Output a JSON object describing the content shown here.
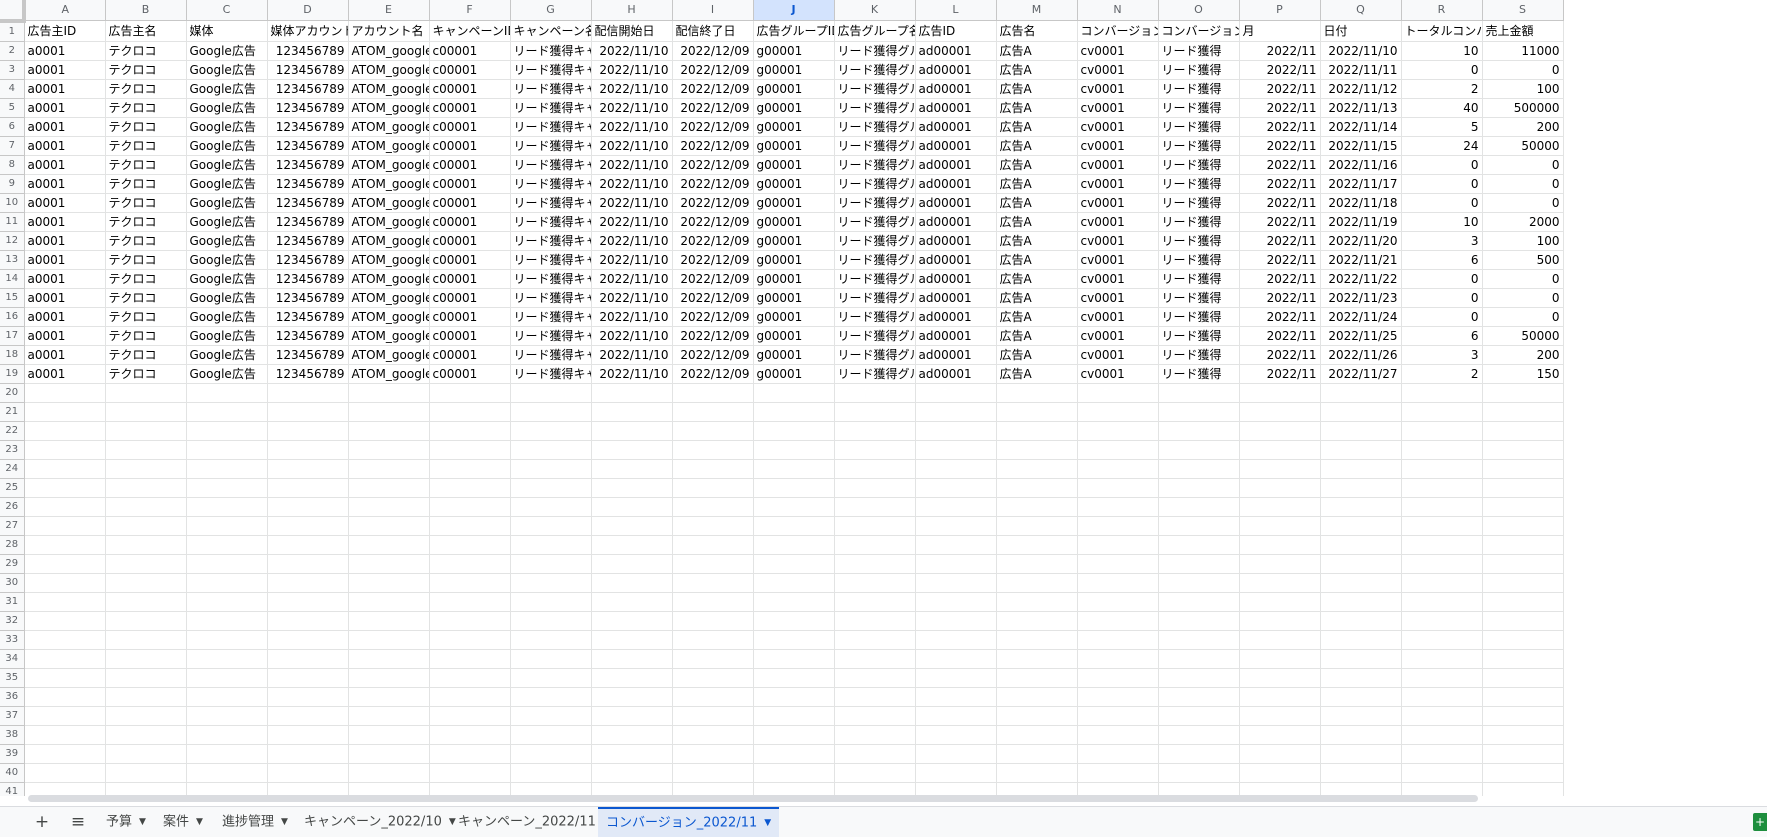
{
  "sheet": {
    "columns": [
      "A",
      "B",
      "C",
      "D",
      "E",
      "F",
      "G",
      "H",
      "I",
      "J",
      "K",
      "L",
      "M",
      "N",
      "O",
      "P",
      "Q",
      "R",
      "S"
    ],
    "selected_column": "J",
    "header_row": [
      "広告主ID",
      "広告主名",
      "媒体",
      "媒体アカウントI",
      "アカウント名",
      "キャンペーンID",
      "キャンペーン名",
      "配信開始日",
      "配信終了日",
      "広告グループID",
      "広告グループ名",
      "広告ID",
      "広告名",
      "コンバージョンI",
      "コンバージョン名",
      "月",
      "日付",
      "トータルコンバ-",
      "売上金額"
    ],
    "numeric_columns": [
      3,
      7,
      8,
      15,
      16,
      17,
      18
    ],
    "rows": [
      [
        "a0001",
        "テクロコ",
        "Google広告",
        "123456789",
        "ATOM_google",
        "c00001",
        "リード獲得キャン",
        "2022/11/10",
        "2022/12/09",
        "g00001",
        "リード獲得グルー",
        "ad00001",
        "広告A",
        "cv0001",
        "リード獲得",
        "2022/11",
        "2022/11/10",
        "10",
        "11000"
      ],
      [
        "a0001",
        "テクロコ",
        "Google広告",
        "123456789",
        "ATOM_google",
        "c00001",
        "リード獲得キャン",
        "2022/11/10",
        "2022/12/09",
        "g00001",
        "リード獲得グルー",
        "ad00001",
        "広告A",
        "cv0001",
        "リード獲得",
        "2022/11",
        "2022/11/11",
        "0",
        "0"
      ],
      [
        "a0001",
        "テクロコ",
        "Google広告",
        "123456789",
        "ATOM_google",
        "c00001",
        "リード獲得キャン",
        "2022/11/10",
        "2022/12/09",
        "g00001",
        "リード獲得グルー",
        "ad00001",
        "広告A",
        "cv0001",
        "リード獲得",
        "2022/11",
        "2022/11/12",
        "2",
        "100"
      ],
      [
        "a0001",
        "テクロコ",
        "Google広告",
        "123456789",
        "ATOM_google",
        "c00001",
        "リード獲得キャン",
        "2022/11/10",
        "2022/12/09",
        "g00001",
        "リード獲得グルー",
        "ad00001",
        "広告A",
        "cv0001",
        "リード獲得",
        "2022/11",
        "2022/11/13",
        "40",
        "500000"
      ],
      [
        "a0001",
        "テクロコ",
        "Google広告",
        "123456789",
        "ATOM_google",
        "c00001",
        "リード獲得キャン",
        "2022/11/10",
        "2022/12/09",
        "g00001",
        "リード獲得グルー",
        "ad00001",
        "広告A",
        "cv0001",
        "リード獲得",
        "2022/11",
        "2022/11/14",
        "5",
        "200"
      ],
      [
        "a0001",
        "テクロコ",
        "Google広告",
        "123456789",
        "ATOM_google",
        "c00001",
        "リード獲得キャン",
        "2022/11/10",
        "2022/12/09",
        "g00001",
        "リード獲得グルー",
        "ad00001",
        "広告A",
        "cv0001",
        "リード獲得",
        "2022/11",
        "2022/11/15",
        "24",
        "50000"
      ],
      [
        "a0001",
        "テクロコ",
        "Google広告",
        "123456789",
        "ATOM_google",
        "c00001",
        "リード獲得キャン",
        "2022/11/10",
        "2022/12/09",
        "g00001",
        "リード獲得グルー",
        "ad00001",
        "広告A",
        "cv0001",
        "リード獲得",
        "2022/11",
        "2022/11/16",
        "0",
        "0"
      ],
      [
        "a0001",
        "テクロコ",
        "Google広告",
        "123456789",
        "ATOM_google",
        "c00001",
        "リード獲得キャン",
        "2022/11/10",
        "2022/12/09",
        "g00001",
        "リード獲得グルー",
        "ad00001",
        "広告A",
        "cv0001",
        "リード獲得",
        "2022/11",
        "2022/11/17",
        "0",
        "0"
      ],
      [
        "a0001",
        "テクロコ",
        "Google広告",
        "123456789",
        "ATOM_google",
        "c00001",
        "リード獲得キャン",
        "2022/11/10",
        "2022/12/09",
        "g00001",
        "リード獲得グルー",
        "ad00001",
        "広告A",
        "cv0001",
        "リード獲得",
        "2022/11",
        "2022/11/18",
        "0",
        "0"
      ],
      [
        "a0001",
        "テクロコ",
        "Google広告",
        "123456789",
        "ATOM_google",
        "c00001",
        "リード獲得キャン",
        "2022/11/10",
        "2022/12/09",
        "g00001",
        "リード獲得グルー",
        "ad00001",
        "広告A",
        "cv0001",
        "リード獲得",
        "2022/11",
        "2022/11/19",
        "10",
        "2000"
      ],
      [
        "a0001",
        "テクロコ",
        "Google広告",
        "123456789",
        "ATOM_google",
        "c00001",
        "リード獲得キャン",
        "2022/11/10",
        "2022/12/09",
        "g00001",
        "リード獲得グルー",
        "ad00001",
        "広告A",
        "cv0001",
        "リード獲得",
        "2022/11",
        "2022/11/20",
        "3",
        "100"
      ],
      [
        "a0001",
        "テクロコ",
        "Google広告",
        "123456789",
        "ATOM_google",
        "c00001",
        "リード獲得キャン",
        "2022/11/10",
        "2022/12/09",
        "g00001",
        "リード獲得グルー",
        "ad00001",
        "広告A",
        "cv0001",
        "リード獲得",
        "2022/11",
        "2022/11/21",
        "6",
        "500"
      ],
      [
        "a0001",
        "テクロコ",
        "Google広告",
        "123456789",
        "ATOM_google",
        "c00001",
        "リード獲得キャン",
        "2022/11/10",
        "2022/12/09",
        "g00001",
        "リード獲得グルー",
        "ad00001",
        "広告A",
        "cv0001",
        "リード獲得",
        "2022/11",
        "2022/11/22",
        "0",
        "0"
      ],
      [
        "a0001",
        "テクロコ",
        "Google広告",
        "123456789",
        "ATOM_google",
        "c00001",
        "リード獲得キャン",
        "2022/11/10",
        "2022/12/09",
        "g00001",
        "リード獲得グルー",
        "ad00001",
        "広告A",
        "cv0001",
        "リード獲得",
        "2022/11",
        "2022/11/23",
        "0",
        "0"
      ],
      [
        "a0001",
        "テクロコ",
        "Google広告",
        "123456789",
        "ATOM_google",
        "c00001",
        "リード獲得キャン",
        "2022/11/10",
        "2022/12/09",
        "g00001",
        "リード獲得グルー",
        "ad00001",
        "広告A",
        "cv0001",
        "リード獲得",
        "2022/11",
        "2022/11/24",
        "0",
        "0"
      ],
      [
        "a0001",
        "テクロコ",
        "Google広告",
        "123456789",
        "ATOM_google",
        "c00001",
        "リード獲得キャン",
        "2022/11/10",
        "2022/12/09",
        "g00001",
        "リード獲得グルー",
        "ad00001",
        "広告A",
        "cv0001",
        "リード獲得",
        "2022/11",
        "2022/11/25",
        "6",
        "50000"
      ],
      [
        "a0001",
        "テクロコ",
        "Google広告",
        "123456789",
        "ATOM_google",
        "c00001",
        "リード獲得キャン",
        "2022/11/10",
        "2022/12/09",
        "g00001",
        "リード獲得グルー",
        "ad00001",
        "広告A",
        "cv0001",
        "リード獲得",
        "2022/11",
        "2022/11/26",
        "3",
        "200"
      ],
      [
        "a0001",
        "テクロコ",
        "Google広告",
        "123456789",
        "ATOM_google",
        "c00001",
        "リード獲得キャン",
        "2022/11/10",
        "2022/12/09",
        "g00001",
        "リード獲得グルー",
        "ad00001",
        "広告A",
        "cv0001",
        "リード獲得",
        "2022/11",
        "2022/11/27",
        "2",
        "150"
      ]
    ],
    "row_numbers": [
      "1",
      "2",
      "3",
      "4",
      "5",
      "6",
      "7",
      "8",
      "9",
      "10",
      "11",
      "12",
      "13",
      "14",
      "15",
      "16",
      "17",
      "18",
      "19",
      "20",
      "21",
      "22",
      "23",
      "24",
      "25",
      "26",
      "27",
      "28",
      "29",
      "30",
      "31",
      "32",
      "33",
      "34",
      "35",
      "36",
      "37",
      "38",
      "39",
      "40",
      "41"
    ]
  },
  "tabbar": {
    "add_icon": "plus-icon",
    "list_icon": "menu-icon",
    "tabs": [
      {
        "label": "予算",
        "active": false
      },
      {
        "label": "案件",
        "active": false
      },
      {
        "label": "進捗管理",
        "active": false
      },
      {
        "label": "キャンペーン_2022/10",
        "active": false
      },
      {
        "label": "キャンペーン_2022/11",
        "active": false
      },
      {
        "label": "コンバージョン_2022/11",
        "active": true
      }
    ],
    "active_color": "#0b57d0"
  }
}
